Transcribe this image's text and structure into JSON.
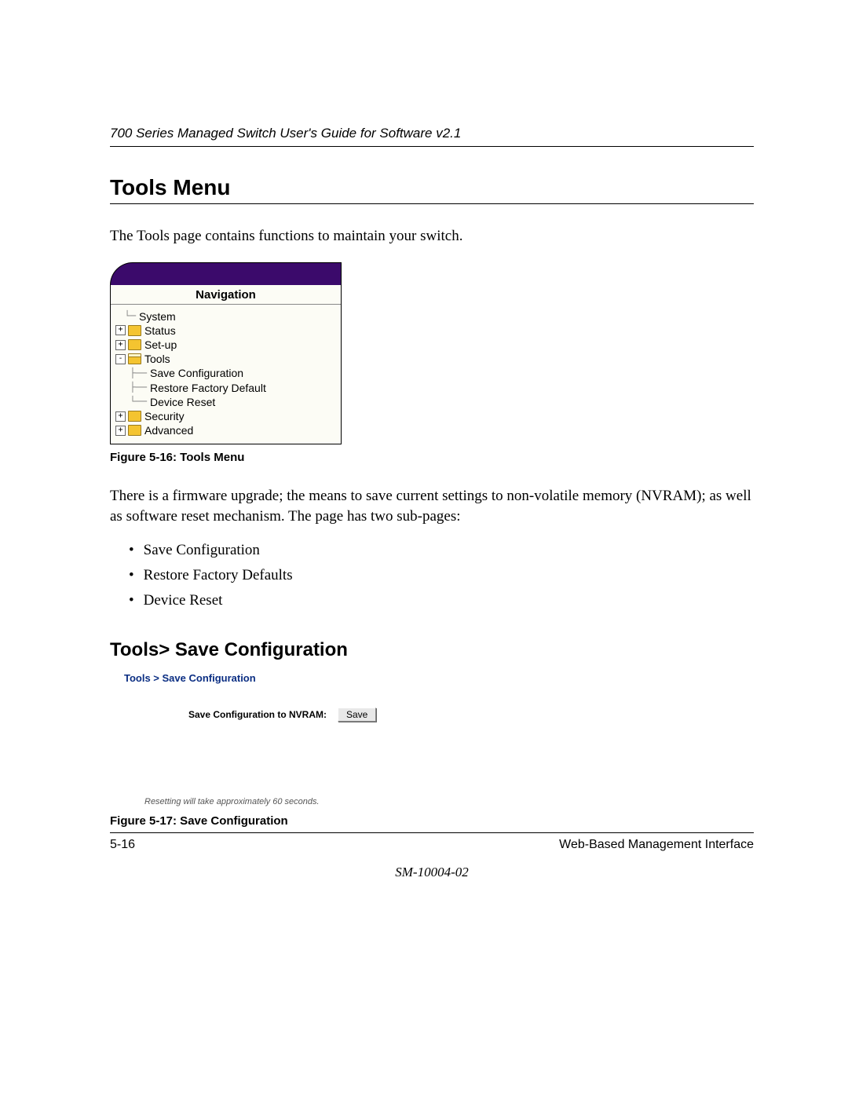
{
  "header": {
    "doc_title": "700 Series Managed Switch User's Guide for Software v2.1"
  },
  "section": {
    "h1": "Tools Menu",
    "intro": "The Tools page contains functions to maintain your switch.",
    "body": "There is a firmware upgrade; the means to save current settings to non-volatile memory (NVRAM); as well as software reset mechanism. The page has two sub-pages:",
    "bullets": [
      "Save Configuration",
      "Restore Factory Defaults",
      "Device Reset"
    ],
    "h2": "Tools> Save Configuration"
  },
  "figure1": {
    "nav_title": "Navigation",
    "items": {
      "system": "System",
      "status": "Status",
      "setup": "Set-up",
      "tools": "Tools",
      "tools_children": [
        "Save Configuration",
        "Restore Factory Default",
        "Device Reset"
      ],
      "security": "Security",
      "advanced": "Advanced"
    },
    "caption": "Figure 5-16:  Tools Menu"
  },
  "figure2": {
    "crumb": "Tools > Save Configuration",
    "label": "Save Configuration to NVRAM:",
    "button": "Save",
    "note": "Resetting will take approximately 60 seconds.",
    "caption": "Figure 5-17:  Save Configuration"
  },
  "footer": {
    "page": "5-16",
    "right": "Web-Based Management Interface",
    "doc_id": "SM-10004-02"
  }
}
